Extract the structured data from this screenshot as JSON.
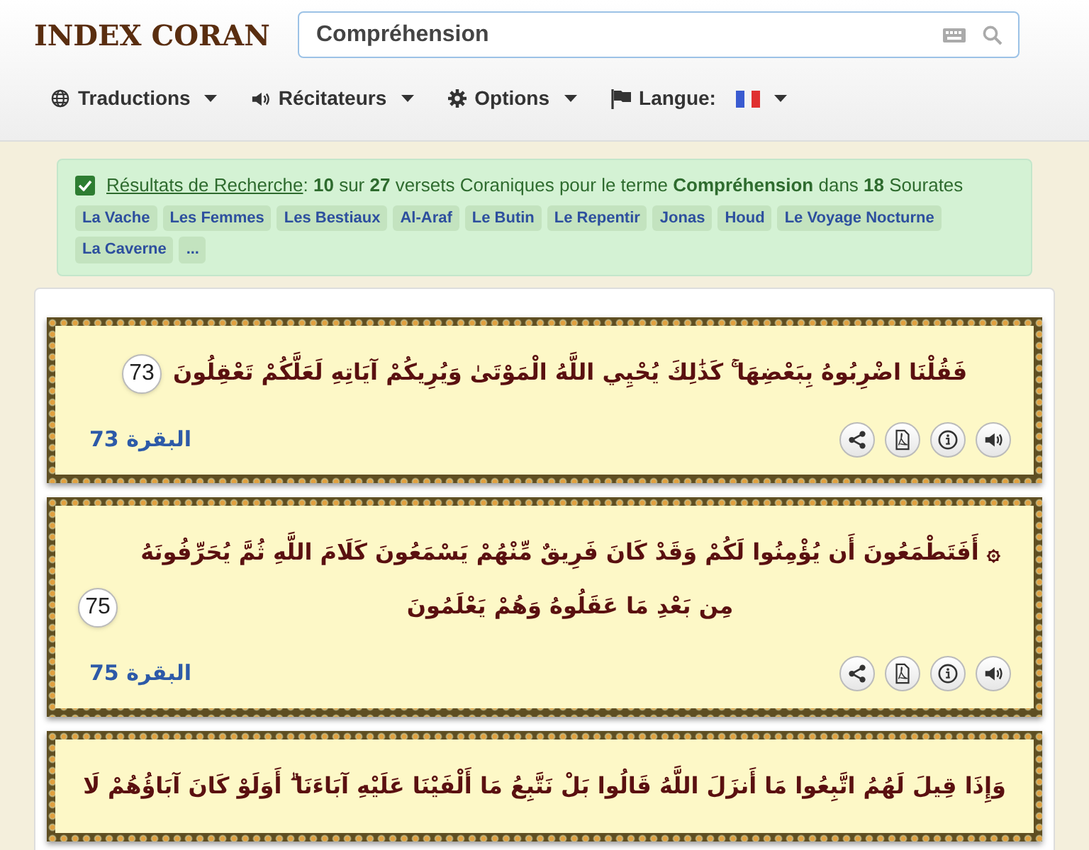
{
  "logo": {
    "text": "INDEX CORAN"
  },
  "search": {
    "value": "Compréhension"
  },
  "nav": [
    {
      "kind": "globe",
      "label": "Traductions"
    },
    {
      "kind": "speaker",
      "label": "Récitateurs"
    },
    {
      "kind": "gear",
      "label": "Options"
    },
    {
      "kind": "flag",
      "label": "Langue:"
    }
  ],
  "results": {
    "checked": true,
    "link": "Résultats de Recherche",
    "summary": ": **10** sur **27** versets Coraniques pour le terme **Compréhension** dans **18** Sourates",
    "tags": [
      "La Vache",
      "Les Femmes",
      "Les Bestiaux",
      "Al-Araf",
      "Le Butin",
      "Le Repentir",
      "Jonas",
      "Houd",
      "Le Voyage Nocturne",
      "La Caverne",
      "..."
    ]
  },
  "verses": [
    {
      "text": "فَقُلْنَا اضْرِبُوهُ بِبَعْضِهَا ۚ كَذَٰلِكَ يُحْيِي اللَّهُ الْمَوْتَىٰ وَيُرِيكُمْ آيَاتِهِ لَعَلَّكُمْ تَعْقِلُونَ",
      "number": "73",
      "reference": "البقرة 73"
    },
    {
      "text": "۞ أَفَتَطْمَعُونَ أَن يُؤْمِنُوا لَكُمْ وَقَدْ كَانَ فَرِيقٌ مِّنْهُمْ يَسْمَعُونَ كَلَامَ اللَّهِ ثُمَّ يُحَرِّفُونَهُ مِن بَعْدِ مَا عَقَلُوهُ وَهُمْ يَعْلَمُونَ",
      "number": "75",
      "reference": "البقرة 75"
    },
    {
      "text": "وَإِذَا قِيلَ لَهُمُ اتَّبِعُوا مَا أَنزَلَ اللَّهُ قَالُوا بَلْ نَتَّبِعُ مَا أَلْفَيْنَا عَلَيْهِ آبَاءَنَا ۗ أَوَلَوْ كَانَ آبَاؤُهُمْ لَا"
    }
  ]
}
